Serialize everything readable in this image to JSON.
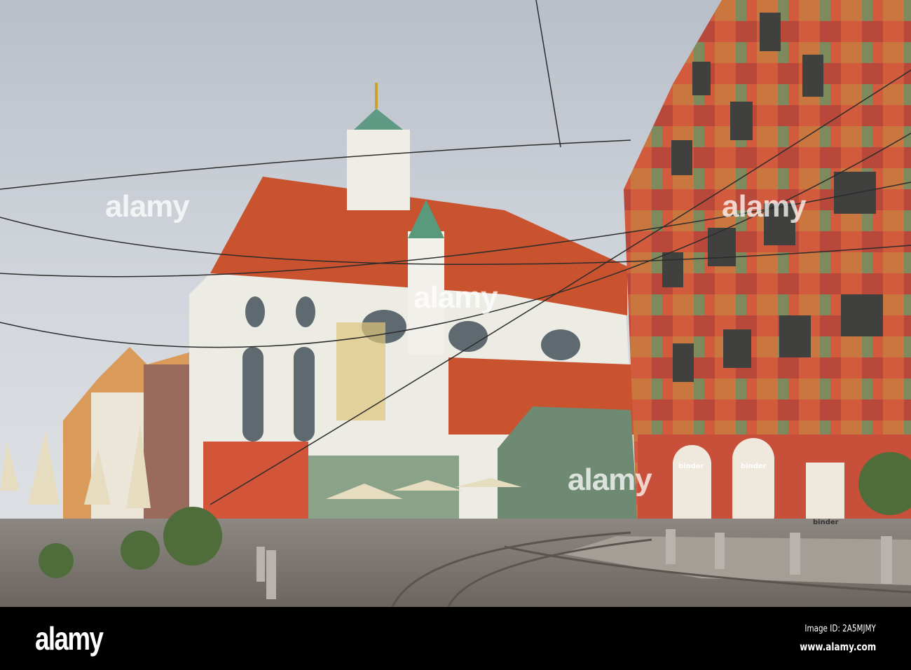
{
  "scene": {
    "description_colors": {
      "sky": "#c9ced6",
      "church_wall": "#ecebe4",
      "roof": "#c8532e",
      "facade": "#d4553a",
      "cobble": "#7d7670"
    },
    "shop_signs": [
      "binder",
      "binder",
      "binder"
    ]
  },
  "watermark": {
    "text": "alamy"
  },
  "footer": {
    "logo": "alamy",
    "image_id": "Image ID: 2A5MJMY",
    "website": "www.alamy.com"
  }
}
